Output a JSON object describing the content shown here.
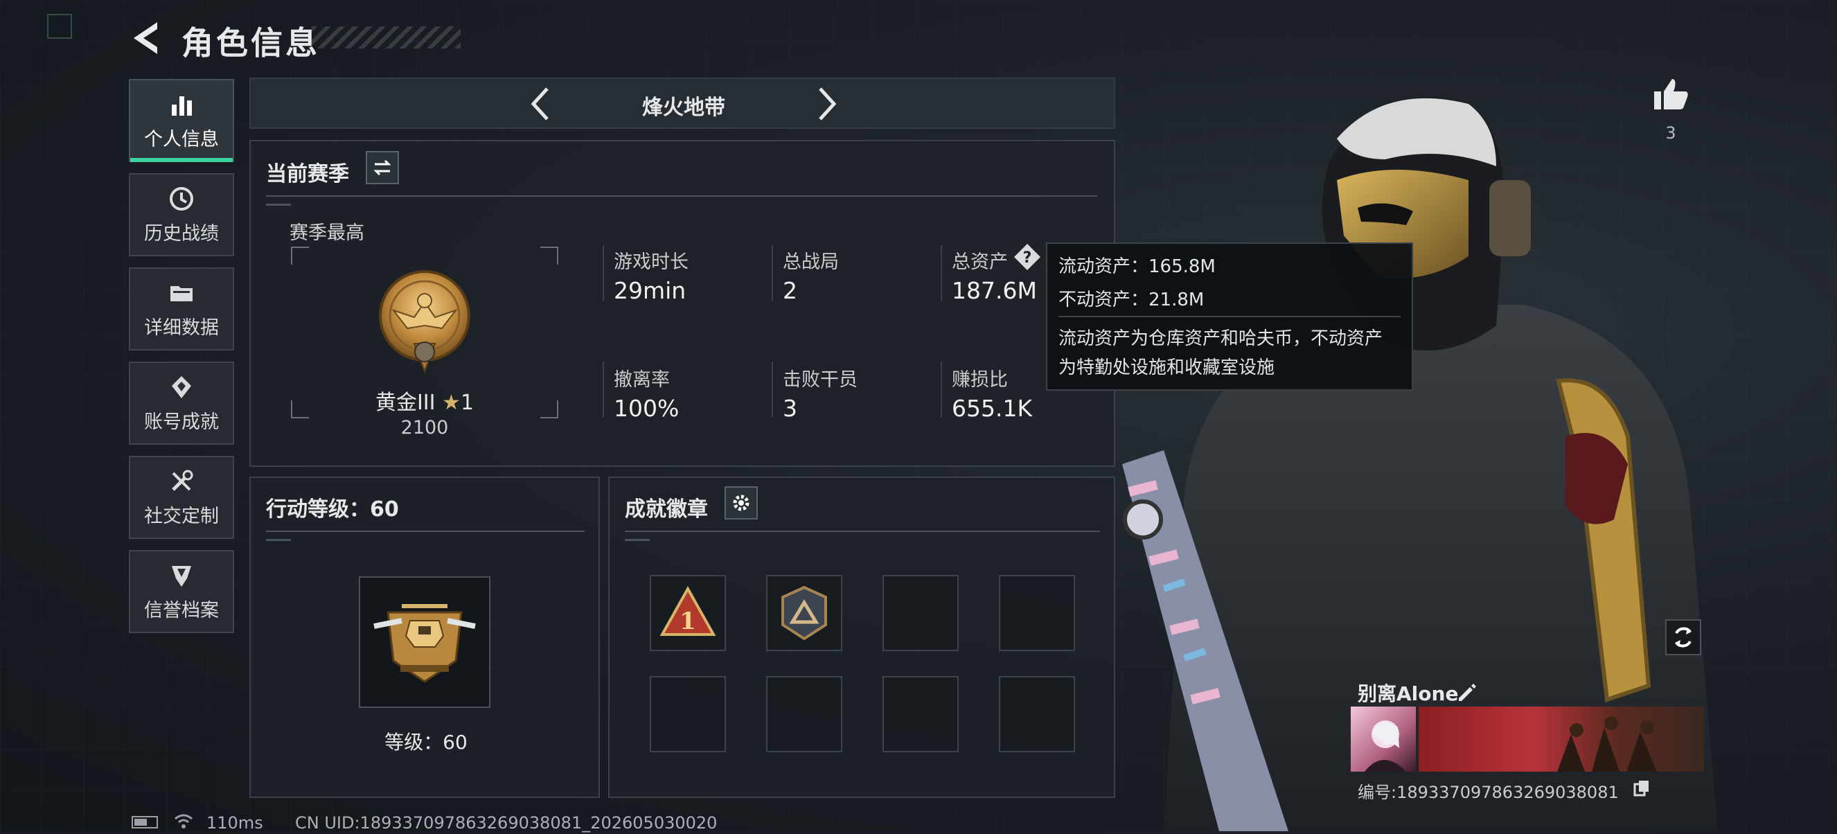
{
  "header": {
    "title": "角色信息"
  },
  "sidebar": {
    "items": [
      {
        "label": "个人信息",
        "icon": "bar-chart-icon",
        "active": true
      },
      {
        "label": "历史战绩",
        "icon": "history-icon",
        "active": false
      },
      {
        "label": "详细数据",
        "icon": "folder-icon",
        "active": false
      },
      {
        "label": "账号成就",
        "icon": "achievement-icon",
        "active": false
      },
      {
        "label": "社交定制",
        "icon": "tools-icon",
        "active": false
      },
      {
        "label": "信誉档案",
        "icon": "reputation-icon",
        "active": false
      }
    ]
  },
  "mode_selector": {
    "current": "烽火地带"
  },
  "season": {
    "title": "当前赛季",
    "best_label": "赛季最高",
    "rank_name": "黄金III",
    "rank_stars": "1",
    "rank_points": "2100",
    "stats": [
      {
        "label": "游戏时长",
        "value": "29min"
      },
      {
        "label": "总战局",
        "value": "2"
      },
      {
        "label": "总资产",
        "value": "187.6M"
      },
      {
        "label": "撤离率",
        "value": "100%"
      },
      {
        "label": "击败干员",
        "value": "3"
      },
      {
        "label": "赚损比",
        "value": "655.1K"
      }
    ]
  },
  "tooltip": {
    "line1": "流动资产：165.8M",
    "line2": "不动资产：21.8M",
    "desc1": "流动资产为仓库资产和哈夫币，不动资产",
    "desc2": "为特勤处设施和收藏室设施"
  },
  "action_level": {
    "title": "行动等级：60",
    "level_text": "等级：60"
  },
  "achievements": {
    "title": "成就徽章",
    "badges": [
      "rank-1-badge",
      "triangle-badge",
      "",
      "",
      "",
      "",
      "",
      ""
    ]
  },
  "likes": {
    "count": "3"
  },
  "player": {
    "name": "别离Alone",
    "id_text": "编号:1893370978632690380​81"
  },
  "status_bar": {
    "ping": "110ms",
    "uid": "CN UID:18933709786326903808​1_202605030020"
  },
  "colors": {
    "accent": "#3fd3a0",
    "gold": "#c89a4a",
    "panel": "#1c2228"
  }
}
